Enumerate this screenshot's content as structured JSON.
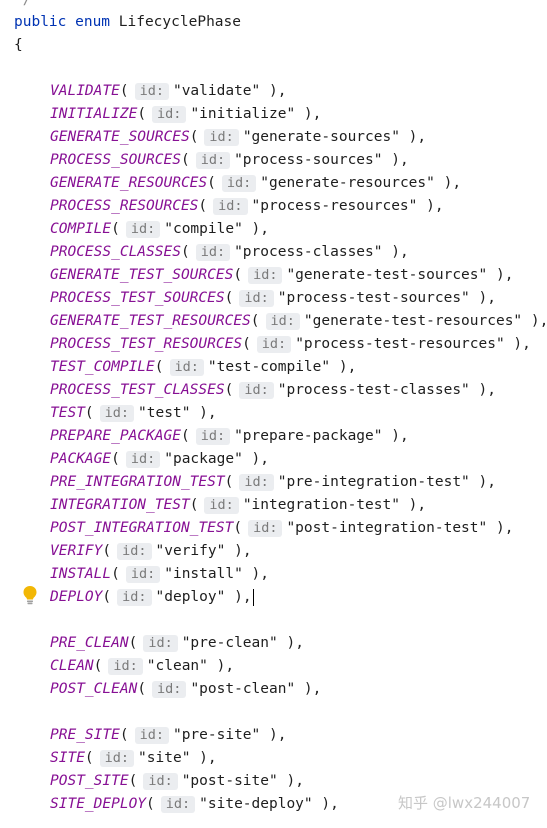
{
  "editor": {
    "top_comment": "*/",
    "declaration_keywords": "public enum",
    "declaration_name": "LifecyclePhase",
    "open_brace": "{",
    "param_hint": "id:",
    "entries": [
      {
        "name": "VALIDATE",
        "value": "\"validate\""
      },
      {
        "name": "INITIALIZE",
        "value": "\"initialize\""
      },
      {
        "name": "GENERATE_SOURCES",
        "value": "\"generate-sources\""
      },
      {
        "name": "PROCESS_SOURCES",
        "value": "\"process-sources\""
      },
      {
        "name": "GENERATE_RESOURCES",
        "value": "\"generate-resources\""
      },
      {
        "name": "PROCESS_RESOURCES",
        "value": "\"process-resources\""
      },
      {
        "name": "COMPILE",
        "value": "\"compile\""
      },
      {
        "name": "PROCESS_CLASSES",
        "value": "\"process-classes\""
      },
      {
        "name": "GENERATE_TEST_SOURCES",
        "value": "\"generate-test-sources\""
      },
      {
        "name": "PROCESS_TEST_SOURCES",
        "value": "\"process-test-sources\""
      },
      {
        "name": "GENERATE_TEST_RESOURCES",
        "value": "\"generate-test-resources\""
      },
      {
        "name": "PROCESS_TEST_RESOURCES",
        "value": "\"process-test-resources\""
      },
      {
        "name": "TEST_COMPILE",
        "value": "\"test-compile\""
      },
      {
        "name": "PROCESS_TEST_CLASSES",
        "value": "\"process-test-classes\""
      },
      {
        "name": "TEST",
        "value": "\"test\""
      },
      {
        "name": "PREPARE_PACKAGE",
        "value": "\"prepare-package\""
      },
      {
        "name": "PACKAGE",
        "value": "\"package\""
      },
      {
        "name": "PRE_INTEGRATION_TEST",
        "value": "\"pre-integration-test\""
      },
      {
        "name": "INTEGRATION_TEST",
        "value": "\"integration-test\""
      },
      {
        "name": "POST_INTEGRATION_TEST",
        "value": "\"post-integration-test\""
      },
      {
        "name": "VERIFY",
        "value": "\"verify\""
      },
      {
        "name": "INSTALL",
        "value": "\"install\""
      },
      {
        "name": "DEPLOY",
        "value": "\"deploy\""
      },
      {
        "name": "PRE_CLEAN",
        "value": "\"pre-clean\""
      },
      {
        "name": "CLEAN",
        "value": "\"clean\""
      },
      {
        "name": "POST_CLEAN",
        "value": "\"post-clean\""
      },
      {
        "name": "PRE_SITE",
        "value": "\"pre-site\""
      },
      {
        "name": "SITE",
        "value": "\"site\""
      },
      {
        "name": "POST_SITE",
        "value": "\"post-site\""
      },
      {
        "name": "SITE_DEPLOY",
        "value": "\"site-deploy\""
      }
    ],
    "open_paren": "(",
    "close_suffix": " ),",
    "colors": {
      "keyword": "#0033b3",
      "constant": "#871094",
      "hint_background": "#ebedf0",
      "bulb": "#f2b705"
    }
  },
  "watermark": "知乎 @lwx244007"
}
